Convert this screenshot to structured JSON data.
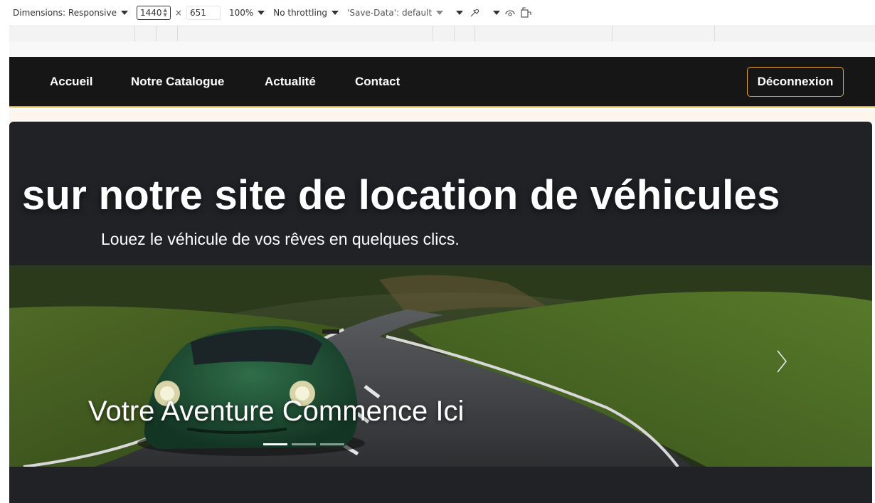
{
  "devtools": {
    "dimensions_label": "Dimensions: Responsive",
    "width_value": "1440",
    "times": "×",
    "height_value": "651",
    "zoom": "100%",
    "throttling": "No throttling",
    "save_data": "'Save-Data': default"
  },
  "navbar": {
    "links": [
      "Accueil",
      "Notre Catalogue",
      "Actualité",
      "Contact"
    ],
    "logout_label": "Déconnexion",
    "accent_color": "#e0a43a"
  },
  "hero": {
    "title": "sur notre site de location de véhicules",
    "subtitle": "Louez le véhicule de vos rêves en quelques clics.",
    "carousel": {
      "caption": "Votre Aventure Commence Ici",
      "slide_count": 3,
      "active_slide": 1,
      "next_icon": "chevron-right-icon"
    }
  }
}
